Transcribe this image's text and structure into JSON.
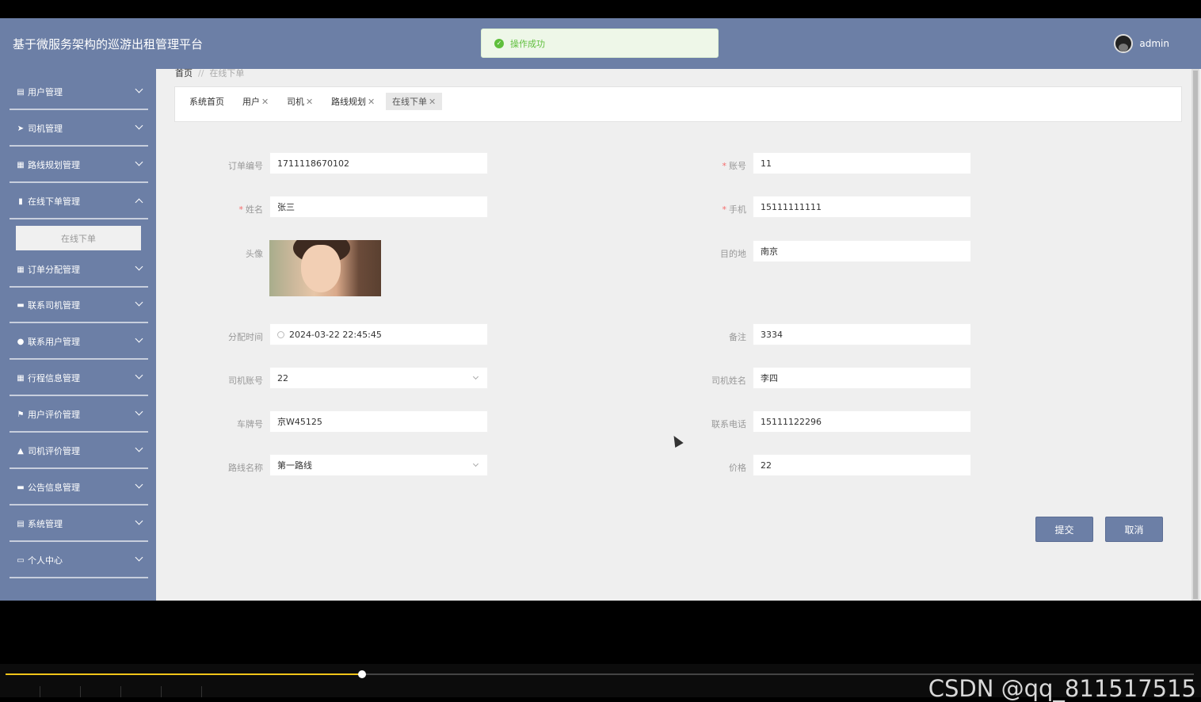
{
  "header": {
    "app_title": "基于微服务架构的巡游出租管理平台",
    "toast": "操作成功",
    "user": "admin"
  },
  "sidebar": {
    "items": [
      {
        "label": "用户管理",
        "icon": "clipboard-icon",
        "glyph": "▤"
      },
      {
        "label": "司机管理",
        "icon": "send-icon",
        "glyph": "➤"
      },
      {
        "label": "路线规划管理",
        "icon": "grid-icon",
        "glyph": "▦"
      },
      {
        "label": "在线下单管理",
        "icon": "bar-chart-icon",
        "glyph": "▮"
      },
      {
        "label": "订单分配管理",
        "icon": "grid-icon",
        "glyph": "▦"
      },
      {
        "label": "联系司机管理",
        "icon": "monitor-icon",
        "glyph": "▬"
      },
      {
        "label": "联系用户管理",
        "icon": "bulb-icon",
        "glyph": "●"
      },
      {
        "label": "行程信息管理",
        "icon": "grid-icon",
        "glyph": "▦"
      },
      {
        "label": "用户评价管理",
        "icon": "flag-icon",
        "glyph": "⚑"
      },
      {
        "label": "司机评价管理",
        "icon": "thumbs-up-icon",
        "glyph": "▲"
      },
      {
        "label": "公告信息管理",
        "icon": "ticket-icon",
        "glyph": "▬"
      },
      {
        "label": "系统管理",
        "icon": "clipboard-icon",
        "glyph": "▤"
      },
      {
        "label": "个人中心",
        "icon": "card-icon",
        "glyph": "▭"
      }
    ],
    "sub_item": "在线下单"
  },
  "breadcrumb": {
    "home": "首页",
    "separator": "//",
    "current": "在线下单"
  },
  "tabs": [
    {
      "label": "系统首页",
      "closable": false
    },
    {
      "label": "用户",
      "closable": true
    },
    {
      "label": "司机",
      "closable": true
    },
    {
      "label": "路线规划",
      "closable": true
    },
    {
      "label": "在线下单",
      "closable": true,
      "active": true
    }
  ],
  "form": {
    "order_no": {
      "label": "订单编号",
      "value": "1711118670102"
    },
    "account": {
      "label": "账号",
      "value": "11",
      "required": true
    },
    "name": {
      "label": "姓名",
      "value": "张三",
      "required": true
    },
    "phone": {
      "label": "手机",
      "value": "15111111111",
      "required": true
    },
    "avatar": {
      "label": "头像"
    },
    "destination": {
      "label": "目的地",
      "value": "南京"
    },
    "assign_time": {
      "label": "分配时间",
      "value": "2024-03-22 22:45:45"
    },
    "remark": {
      "label": "备注",
      "value": "3334"
    },
    "driver_account": {
      "label": "司机账号",
      "value": "22"
    },
    "driver_name": {
      "label": "司机姓名",
      "value": "李四"
    },
    "plate": {
      "label": "车牌号",
      "value": "京W45125"
    },
    "contact_phone": {
      "label": "联系电话",
      "value": "15111122296"
    },
    "route_name": {
      "label": "路线名称",
      "value": "第一路线"
    },
    "price": {
      "label": "价格",
      "value": "22"
    }
  },
  "buttons": {
    "submit": "提交",
    "cancel": "取消"
  },
  "player": {
    "progress": 0.3
  },
  "watermark": "CSDN @qq_811517515",
  "colors": {
    "primary": "#6c7fa6",
    "success": "#5fbf3c",
    "required": "#f56c6c"
  }
}
